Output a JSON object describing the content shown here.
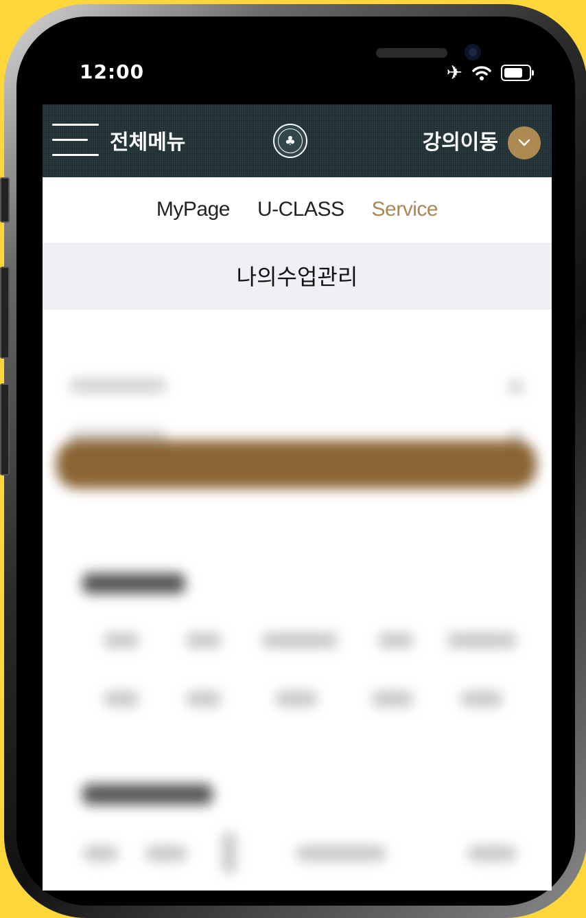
{
  "status_bar": {
    "time": "12:00",
    "icons": [
      "airplane-icon",
      "wifi-icon",
      "battery-icon"
    ]
  },
  "header": {
    "menu_label": "전체메뉴",
    "menu_icon": "hamburger-icon",
    "logo_icon": "university-seal",
    "move_label": "강의이동",
    "move_icon": "chevron-down-icon"
  },
  "tabs": [
    {
      "label": "MyPage",
      "active": false
    },
    {
      "label": "U-CLASS",
      "active": false
    },
    {
      "label": "Service",
      "active": true
    }
  ],
  "page": {
    "title": "나의수업관리"
  },
  "colors": {
    "background": "#fcd63a",
    "header_bg": "#1f3035",
    "accent": "#ad8a52",
    "active_tab": "#a98857",
    "title_bar_bg": "#eef0f3",
    "blurred_bar": "#8a6434"
  }
}
